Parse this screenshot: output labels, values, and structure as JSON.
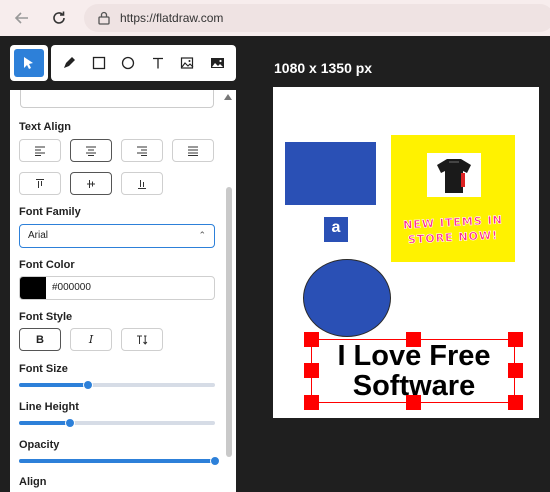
{
  "browser": {
    "url": "https://flatdraw.com"
  },
  "toolbar": {
    "tools": [
      "select-icon",
      "pen-icon",
      "rectangle-icon",
      "ellipse-icon",
      "text-icon",
      "image-icon",
      "image-icon"
    ],
    "accent_color": "#2d80d9"
  },
  "panel": {
    "text_align_label": "Text Align",
    "font_family_label": "Font Family",
    "font_family_value": "Arial",
    "font_color_label": "Font Color",
    "font_color_value": "#000000",
    "font_style_label": "Font Style",
    "bold_label": "B",
    "italic_label": "I",
    "font_size_label": "Font Size",
    "font_size_level": 0.35,
    "line_height_label": "Line Height",
    "line_height_level": 0.26,
    "opacity_label": "Opacity",
    "opacity_level": 1.0,
    "align_label": "Align"
  },
  "canvas": {
    "size_label": "1080 x 1350 px",
    "amazon_letter": "a",
    "promo_line1": "NEW ITEMS IN",
    "promo_line2": "STORE NOW!",
    "text_line1": "I Love Free",
    "text_line2": "Software",
    "shape_color": "#2a50b5",
    "promo_bg": "#fff200",
    "selection_color": "#ff0000"
  }
}
